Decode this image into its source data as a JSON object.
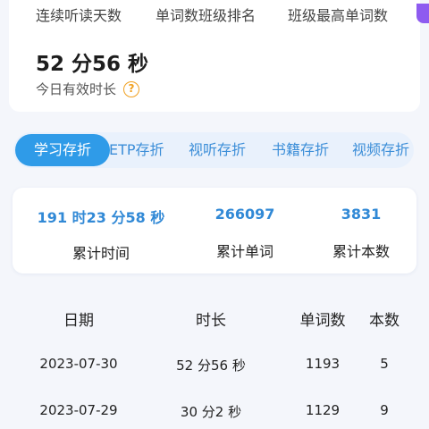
{
  "stats_header": {
    "continuous_days": "连续听读天数",
    "class_rank": "单词数班级排名",
    "class_max": "班级最高单词数"
  },
  "today": {
    "duration": "52 分56 秒",
    "label": "今日有效时长",
    "help_icon": "?"
  },
  "tabs": [
    {
      "label": "学习存折",
      "active": true
    },
    {
      "label": "ETP存折",
      "active": false
    },
    {
      "label": "视听存折",
      "active": false
    },
    {
      "label": "书籍存折",
      "active": false
    },
    {
      "label": "视频存折",
      "active": false
    }
  ],
  "summary": {
    "total_time_value": "191 时23 分58 秒",
    "total_time_label": "累计时间",
    "total_words_value": "266097",
    "total_words_label": "累计单词",
    "total_books_value": "3831",
    "total_books_label": "累计本数"
  },
  "table": {
    "headers": [
      "日期",
      "时长",
      "单词数",
      "本数"
    ],
    "rows": [
      [
        "2023-07-30",
        "52 分56 秒",
        "1193",
        "5"
      ],
      [
        "2023-07-29",
        "30 分2 秒",
        "1129",
        "9"
      ]
    ]
  },
  "colors": {
    "accent": "#2f9be8",
    "value_blue": "#3189d6",
    "help_orange": "#f0a020",
    "corner_purple": "#8e5bf0"
  }
}
